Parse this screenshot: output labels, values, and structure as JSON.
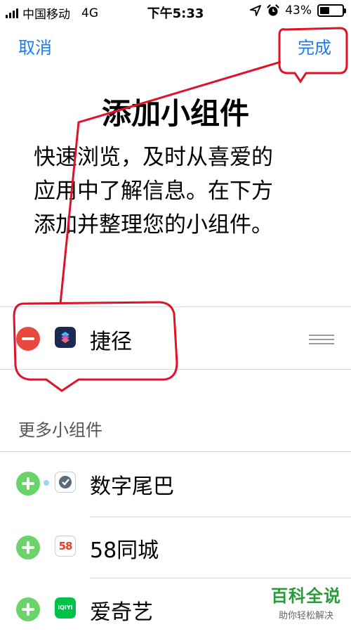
{
  "status": {
    "carrier": "中国移动",
    "network": "4G",
    "time": "下午5:33",
    "battery": "43%",
    "battery_level": 0.43,
    "icons": [
      "signal-icon",
      "location-icon",
      "alarm-icon",
      "battery-icon"
    ]
  },
  "nav": {
    "cancel": "取消",
    "done": "完成"
  },
  "title": "添加小组件",
  "description": [
    "快速浏览，及时从喜爱的",
    "应用中了解信息。在下方",
    "添加并整理您的小组件。"
  ],
  "added_widgets": [
    {
      "label": "捷径",
      "icon": "shortcuts-icon"
    }
  ],
  "more_section": "更多小组件",
  "more_widgets": [
    {
      "label": "数字尾巴",
      "icon": "dgtle-icon"
    },
    {
      "label": "58同城",
      "icon": "58tongcheng-icon",
      "icon_text": "58"
    },
    {
      "label": "爱奇艺",
      "icon": "iqiyi-icon",
      "icon_text": "iQIYI"
    }
  ],
  "watermark": {
    "title": "百科全说",
    "subtitle": "助你轻松解决"
  },
  "colors": {
    "accent": "#1e7cf0",
    "remove": "#e8483d",
    "add": "#6ad36a",
    "annotation": "#e0122a"
  }
}
